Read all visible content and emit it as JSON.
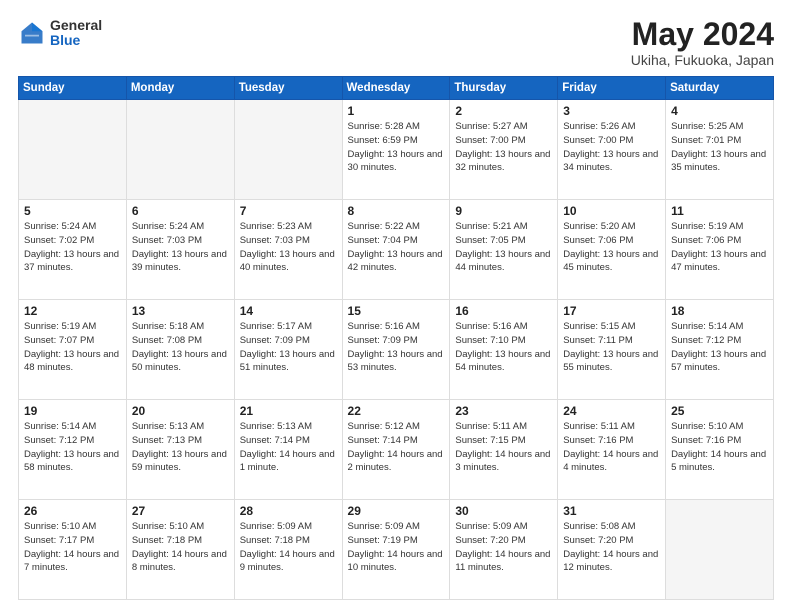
{
  "header": {
    "logo_general": "General",
    "logo_blue": "Blue",
    "title": "May 2024",
    "location": "Ukiha, Fukuoka, Japan"
  },
  "weekdays": [
    "Sunday",
    "Monday",
    "Tuesday",
    "Wednesday",
    "Thursday",
    "Friday",
    "Saturday"
  ],
  "weeks": [
    [
      {
        "day": "",
        "info": ""
      },
      {
        "day": "",
        "info": ""
      },
      {
        "day": "",
        "info": ""
      },
      {
        "day": "1",
        "info": "Sunrise: 5:28 AM\nSunset: 6:59 PM\nDaylight: 13 hours\nand 30 minutes."
      },
      {
        "day": "2",
        "info": "Sunrise: 5:27 AM\nSunset: 7:00 PM\nDaylight: 13 hours\nand 32 minutes."
      },
      {
        "day": "3",
        "info": "Sunrise: 5:26 AM\nSunset: 7:00 PM\nDaylight: 13 hours\nand 34 minutes."
      },
      {
        "day": "4",
        "info": "Sunrise: 5:25 AM\nSunset: 7:01 PM\nDaylight: 13 hours\nand 35 minutes."
      }
    ],
    [
      {
        "day": "5",
        "info": "Sunrise: 5:24 AM\nSunset: 7:02 PM\nDaylight: 13 hours\nand 37 minutes."
      },
      {
        "day": "6",
        "info": "Sunrise: 5:24 AM\nSunset: 7:03 PM\nDaylight: 13 hours\nand 39 minutes."
      },
      {
        "day": "7",
        "info": "Sunrise: 5:23 AM\nSunset: 7:03 PM\nDaylight: 13 hours\nand 40 minutes."
      },
      {
        "day": "8",
        "info": "Sunrise: 5:22 AM\nSunset: 7:04 PM\nDaylight: 13 hours\nand 42 minutes."
      },
      {
        "day": "9",
        "info": "Sunrise: 5:21 AM\nSunset: 7:05 PM\nDaylight: 13 hours\nand 44 minutes."
      },
      {
        "day": "10",
        "info": "Sunrise: 5:20 AM\nSunset: 7:06 PM\nDaylight: 13 hours\nand 45 minutes."
      },
      {
        "day": "11",
        "info": "Sunrise: 5:19 AM\nSunset: 7:06 PM\nDaylight: 13 hours\nand 47 minutes."
      }
    ],
    [
      {
        "day": "12",
        "info": "Sunrise: 5:19 AM\nSunset: 7:07 PM\nDaylight: 13 hours\nand 48 minutes."
      },
      {
        "day": "13",
        "info": "Sunrise: 5:18 AM\nSunset: 7:08 PM\nDaylight: 13 hours\nand 50 minutes."
      },
      {
        "day": "14",
        "info": "Sunrise: 5:17 AM\nSunset: 7:09 PM\nDaylight: 13 hours\nand 51 minutes."
      },
      {
        "day": "15",
        "info": "Sunrise: 5:16 AM\nSunset: 7:09 PM\nDaylight: 13 hours\nand 53 minutes."
      },
      {
        "day": "16",
        "info": "Sunrise: 5:16 AM\nSunset: 7:10 PM\nDaylight: 13 hours\nand 54 minutes."
      },
      {
        "day": "17",
        "info": "Sunrise: 5:15 AM\nSunset: 7:11 PM\nDaylight: 13 hours\nand 55 minutes."
      },
      {
        "day": "18",
        "info": "Sunrise: 5:14 AM\nSunset: 7:12 PM\nDaylight: 13 hours\nand 57 minutes."
      }
    ],
    [
      {
        "day": "19",
        "info": "Sunrise: 5:14 AM\nSunset: 7:12 PM\nDaylight: 13 hours\nand 58 minutes."
      },
      {
        "day": "20",
        "info": "Sunrise: 5:13 AM\nSunset: 7:13 PM\nDaylight: 13 hours\nand 59 minutes."
      },
      {
        "day": "21",
        "info": "Sunrise: 5:13 AM\nSunset: 7:14 PM\nDaylight: 14 hours\nand 1 minute."
      },
      {
        "day": "22",
        "info": "Sunrise: 5:12 AM\nSunset: 7:14 PM\nDaylight: 14 hours\nand 2 minutes."
      },
      {
        "day": "23",
        "info": "Sunrise: 5:11 AM\nSunset: 7:15 PM\nDaylight: 14 hours\nand 3 minutes."
      },
      {
        "day": "24",
        "info": "Sunrise: 5:11 AM\nSunset: 7:16 PM\nDaylight: 14 hours\nand 4 minutes."
      },
      {
        "day": "25",
        "info": "Sunrise: 5:10 AM\nSunset: 7:16 PM\nDaylight: 14 hours\nand 5 minutes."
      }
    ],
    [
      {
        "day": "26",
        "info": "Sunrise: 5:10 AM\nSunset: 7:17 PM\nDaylight: 14 hours\nand 7 minutes."
      },
      {
        "day": "27",
        "info": "Sunrise: 5:10 AM\nSunset: 7:18 PM\nDaylight: 14 hours\nand 8 minutes."
      },
      {
        "day": "28",
        "info": "Sunrise: 5:09 AM\nSunset: 7:18 PM\nDaylight: 14 hours\nand 9 minutes."
      },
      {
        "day": "29",
        "info": "Sunrise: 5:09 AM\nSunset: 7:19 PM\nDaylight: 14 hours\nand 10 minutes."
      },
      {
        "day": "30",
        "info": "Sunrise: 5:09 AM\nSunset: 7:20 PM\nDaylight: 14 hours\nand 11 minutes."
      },
      {
        "day": "31",
        "info": "Sunrise: 5:08 AM\nSunset: 7:20 PM\nDaylight: 14 hours\nand 12 minutes."
      },
      {
        "day": "",
        "info": ""
      }
    ]
  ]
}
